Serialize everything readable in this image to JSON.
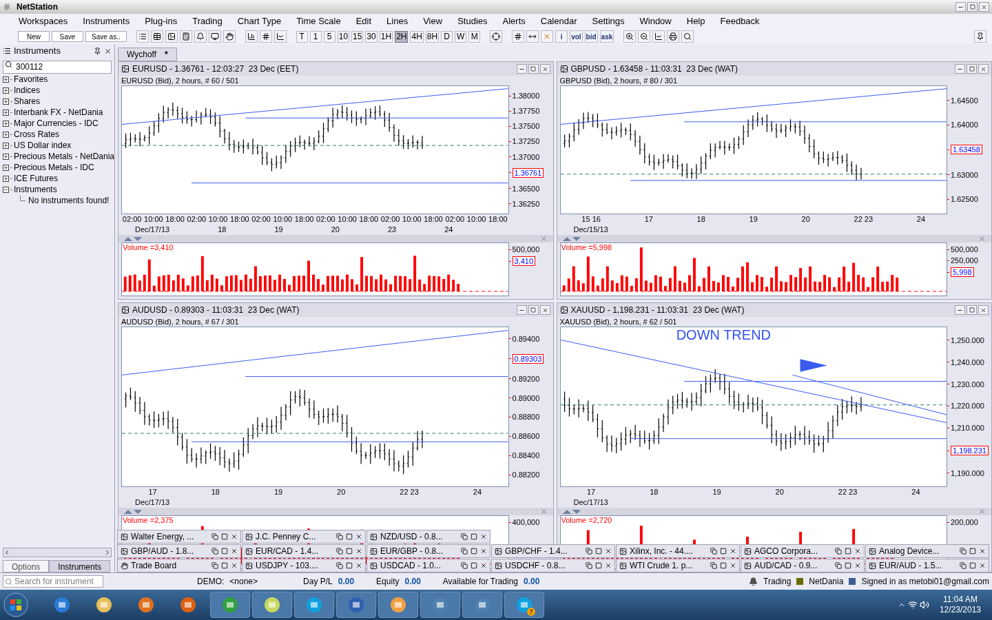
{
  "app": {
    "title": "NetStation"
  },
  "menu": [
    "Workspaces",
    "Instruments",
    "Plug-ins",
    "Trading",
    "Chart Type",
    "Time Scale",
    "Edit",
    "Lines",
    "View",
    "Studies",
    "Alerts",
    "Calendar",
    "Settings",
    "Window",
    "Help",
    "Feedback"
  ],
  "toolbar": {
    "buttons": [
      "New",
      "Save",
      "Save as.."
    ],
    "timescales": [
      {
        "label": "T",
        "selected": false
      },
      {
        "label": "1",
        "selected": false
      },
      {
        "label": "5",
        "selected": false
      },
      {
        "label": "10",
        "selected": false
      },
      {
        "label": "15",
        "selected": false
      },
      {
        "label": "30",
        "selected": false
      },
      {
        "label": "1H",
        "selected": false
      },
      {
        "label": "2H",
        "selected": true
      },
      {
        "label": "4H",
        "selected": false
      },
      {
        "label": "8H",
        "selected": false
      },
      {
        "label": "D",
        "selected": false
      },
      {
        "label": "W",
        "selected": false
      },
      {
        "label": "M",
        "selected": false
      }
    ],
    "text_tools": [
      "i",
      "vol",
      "bid",
      "ask"
    ]
  },
  "sidebar": {
    "title": "Instruments",
    "search": "300112",
    "tree": [
      {
        "label": "Favorites",
        "expanded": false
      },
      {
        "label": "Indices",
        "expanded": false
      },
      {
        "label": "Shares",
        "expanded": false
      },
      {
        "label": "Interbank FX - NetDania",
        "expanded": false
      },
      {
        "label": "Major Currencies - IDC",
        "expanded": false
      },
      {
        "label": "Cross Rates",
        "expanded": false
      },
      {
        "label": "US Dollar index",
        "expanded": false
      },
      {
        "label": "Precious Metals - NetDania",
        "expanded": false
      },
      {
        "label": "Precious Metals - IDC",
        "expanded": false
      },
      {
        "label": "ICE Futures",
        "expanded": false
      },
      {
        "label": "Instruments",
        "expanded": true,
        "children": [
          {
            "label": "No instruments found!"
          }
        ]
      }
    ],
    "tabs": [
      {
        "label": "Options",
        "selected": false
      },
      {
        "label": "Instruments",
        "selected": true
      }
    ]
  },
  "workspace_tab": {
    "label": "Wychoff",
    "mark": "*"
  },
  "charts": [
    {
      "title": "EURUSD - 1.36761 - 12:03:27  23 Dec (EET)",
      "subtitle": "EURUSD (Bid), 2 hours, # 60 / 501",
      "y_labels": [
        {
          "text": "1.38000",
          "kind": "tick"
        },
        {
          "text": "1.37750",
          "kind": "tick"
        },
        {
          "text": "1.37500",
          "kind": "tick"
        },
        {
          "text": "1.37250",
          "kind": "tick"
        },
        {
          "text": "1.37000",
          "kind": "tick"
        },
        {
          "text": "1.36761",
          "kind": "current"
        },
        {
          "text": "1.36500",
          "kind": "tick"
        },
        {
          "text": "1.36250",
          "kind": "tick"
        }
      ],
      "x_rows": [
        [
          "02:00",
          "10:00",
          "18:00",
          "02:00",
          "10:00",
          "18:00",
          "02:00",
          "10:00",
          "18:00",
          "02:00",
          "10:00",
          "18:00",
          "02:00",
          "10:00",
          "18:00",
          "02:00",
          "10:00",
          "18:00"
        ],
        [
          "Dec/17/13",
          "18",
          "19",
          "20",
          "23",
          "24"
        ]
      ],
      "volume": {
        "label": "Volume =3,410",
        "y_labels": [
          {
            "text": "500,000",
            "kind": "tick"
          },
          {
            "text": "3,410",
            "kind": "current"
          }
        ]
      }
    },
    {
      "title": "GBPUSD - 1.63458 - 11:03:31  23 Dec (WAT)",
      "subtitle": "GBPUSD (Bid), 2 hours, # 80 / 301",
      "y_labels": [
        {
          "text": "1.64500",
          "kind": "tick"
        },
        {
          "text": "1.64000",
          "kind": "tick"
        },
        {
          "text": "1.63458",
          "kind": "current"
        },
        {
          "text": "1.63000",
          "kind": "tick"
        },
        {
          "text": "1.62500",
          "kind": "tick"
        }
      ],
      "x_rows": [
        [
          "15 16",
          "17",
          "18",
          "19",
          "20",
          "22 23",
          "24"
        ],
        [
          "Dec/15/13"
        ]
      ],
      "volume": {
        "label": "Volume =5,998",
        "y_labels": [
          {
            "text": "500,000",
            "kind": "tick"
          },
          {
            "text": "250,000",
            "kind": "tick"
          },
          {
            "text": "5,998",
            "kind": "current"
          }
        ]
      }
    },
    {
      "title": "AUDUSD - 0.89303 - 11:03:31  23 Dec (WAT)",
      "subtitle": "AUDUSD (Bid), 2 hours, # 67 / 301",
      "y_labels": [
        {
          "text": "0.89400",
          "kind": "tick"
        },
        {
          "text": "0.89303",
          "kind": "current"
        },
        {
          "text": "0.89200",
          "kind": "tick"
        },
        {
          "text": "0.89000",
          "kind": "tick"
        },
        {
          "text": "0.88800",
          "kind": "tick"
        },
        {
          "text": "0.88600",
          "kind": "tick"
        },
        {
          "text": "0.88400",
          "kind": "tick"
        },
        {
          "text": "0.88200",
          "kind": "tick"
        }
      ],
      "x_rows": [
        [
          "17",
          "18",
          "19",
          "20",
          "22 23",
          "24"
        ],
        [
          "Dec/17/13"
        ]
      ],
      "volume": {
        "label": "Volume =2,375",
        "y_labels": [
          {
            "text": "400,000",
            "kind": "tick"
          }
        ]
      }
    },
    {
      "title": "XAUUSD - 1,198.231 - 11:03:31  23 Dec (WAT)",
      "subtitle": "XAUUSD (Bid), 2 hours, # 62 / 501",
      "annotation": "DOWN TREND",
      "y_labels": [
        {
          "text": "1,250.000",
          "kind": "tick"
        },
        {
          "text": "1,240.000",
          "kind": "tick"
        },
        {
          "text": "1,230.000",
          "kind": "tick"
        },
        {
          "text": "1,220.000",
          "kind": "tick"
        },
        {
          "text": "1,210.000",
          "kind": "tick"
        },
        {
          "text": "1,198.231",
          "kind": "current"
        },
        {
          "text": "1,190.000",
          "kind": "tick"
        }
      ],
      "x_rows": [
        [
          "17",
          "18",
          "19",
          "20",
          "22 23",
          "24"
        ],
        [
          "Dec/17/13"
        ]
      ],
      "volume": {
        "label": "Volume =2,720",
        "y_labels": [
          {
            "text": "200,000",
            "kind": "tick"
          }
        ]
      }
    }
  ],
  "minimized": [
    [
      {
        "title": "Walter Energy, ...",
        "kind": "chart"
      },
      {
        "title": "J.C. Penney C...",
        "kind": "chart"
      },
      {
        "title": "NZD/USD - 0.8...",
        "kind": "chart"
      }
    ],
    [
      {
        "title": "GBP/AUD - 1.8...",
        "kind": "chart"
      },
      {
        "title": "EUR/CAD - 1.4...",
        "kind": "chart"
      },
      {
        "title": "EUR/GBP - 0.8...",
        "kind": "chart"
      },
      {
        "title": "GBP/CHF - 1.4...",
        "kind": "chart"
      },
      {
        "title": "Xilinx, Inc. - 44....",
        "kind": "chart"
      },
      {
        "title": "AGCO Corpora...",
        "kind": "chart"
      },
      {
        "title": "Analog Device...",
        "kind": "chart"
      }
    ],
    [
      {
        "title": "Trade Board",
        "kind": "board"
      },
      {
        "title": "USDJPY - 103....",
        "kind": "chart"
      },
      {
        "title": "USDCAD - 1.0...",
        "kind": "chart"
      },
      {
        "title": "USDCHF - 0.8...",
        "kind": "chart"
      },
      {
        "title": "WTI Crude 1. p...",
        "kind": "chart"
      },
      {
        "title": "AUD/CAD - 0.9...",
        "kind": "chart"
      },
      {
        "title": "EUR/AUD - 1.5...",
        "kind": "chart"
      }
    ]
  ],
  "status_bar": {
    "search_placeholder": "Search for instrument",
    "demo_label": "DEMO:",
    "demo_value": "<none>",
    "figures": [
      {
        "label": "Day P/L",
        "value": "0.00"
      },
      {
        "label": "Equity",
        "value": "0.00"
      },
      {
        "label": "Available for Trading",
        "value": "0.00"
      }
    ],
    "indicators": [
      {
        "label": "Trading",
        "color": "#6b6b00"
      },
      {
        "label": "NetDania",
        "color": "#3b5f8f"
      }
    ],
    "signed_in": "Signed in as metobi01@gmail.com"
  },
  "taskbar": {
    "badge": "7",
    "time": "11:04 AM",
    "date": "12/23/2013"
  }
}
